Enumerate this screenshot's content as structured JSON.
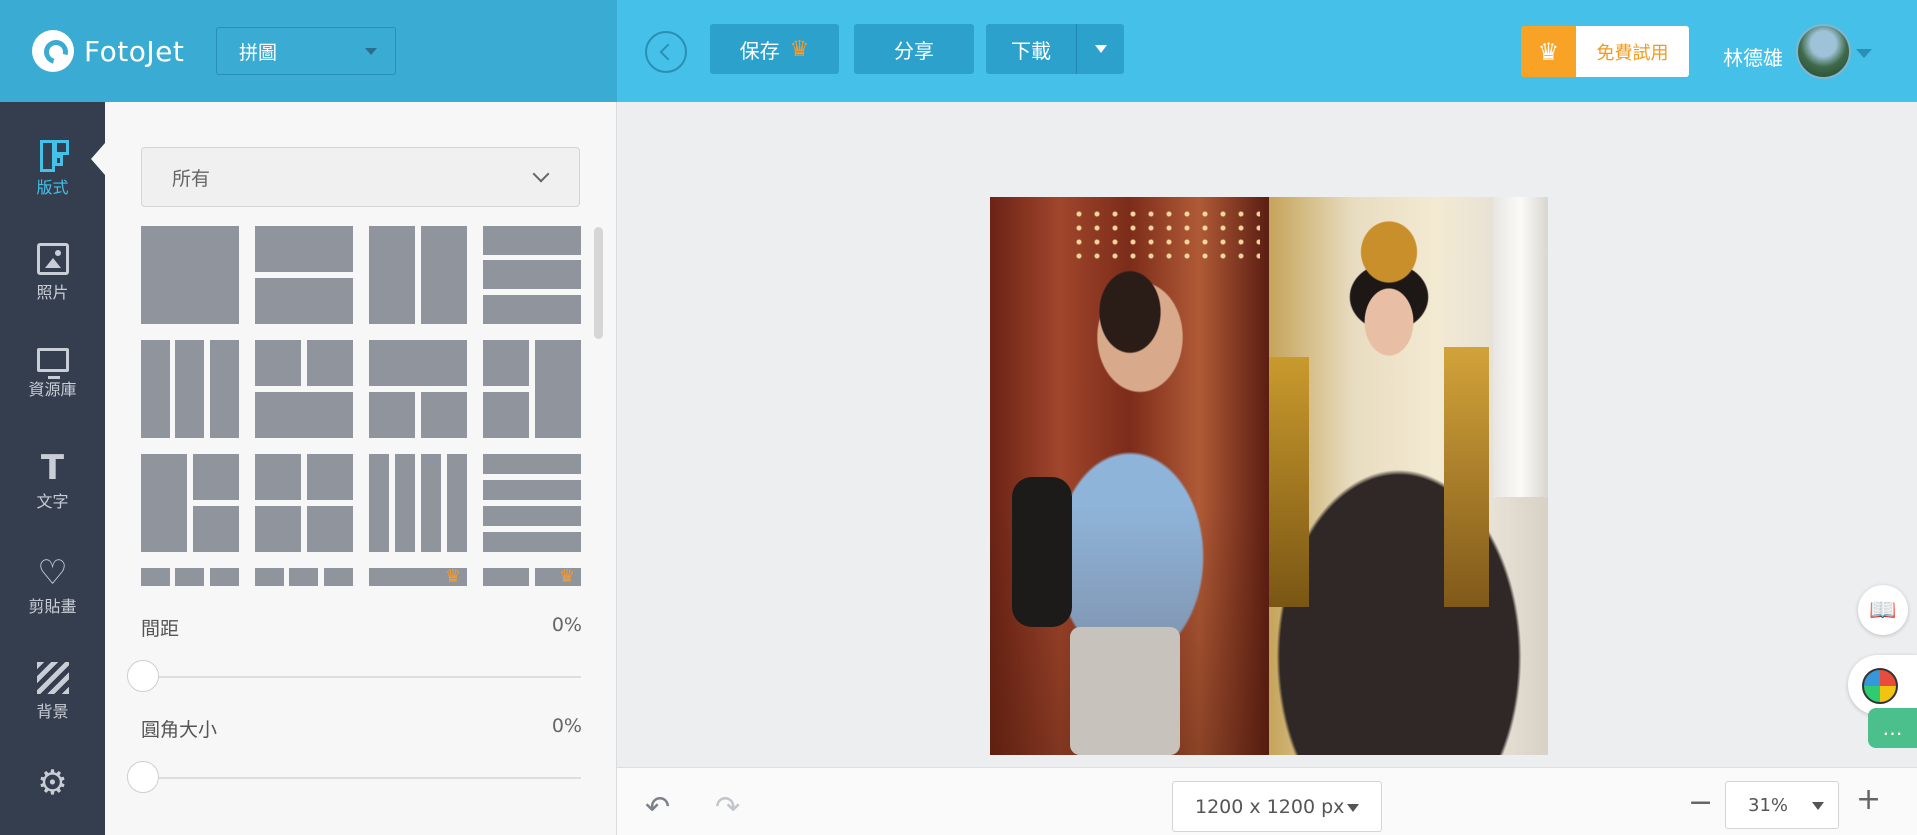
{
  "app": {
    "logo_text": "FotoJet",
    "mode_label": "拼圖"
  },
  "toolbar": {
    "save_label": "保存",
    "share_label": "分享",
    "download_label": "下載",
    "trial_label": "免費試用",
    "username": "林德雄"
  },
  "sidebar": {
    "items": [
      {
        "label": "版式",
        "icon": "layout-icon",
        "active": true
      },
      {
        "label": "照片",
        "icon": "photo-icon",
        "active": false
      },
      {
        "label": "資源庫",
        "icon": "monitor-icon",
        "active": false
      },
      {
        "label": "文字",
        "icon": "text-icon",
        "active": false
      },
      {
        "label": "剪貼畫",
        "icon": "heart-icon",
        "active": false
      },
      {
        "label": "背景",
        "icon": "background-icon",
        "active": false
      }
    ],
    "settings_icon": "gear-icon"
  },
  "panel": {
    "category_value": "所有",
    "spacing_label": "間距",
    "spacing_value": "0%",
    "corner_label": "圓角大小",
    "corner_value": "0%"
  },
  "bottom": {
    "canvas_size": "1200 x 1200 px",
    "zoom": "31%"
  },
  "colors": {
    "header_left": "#3aabd2",
    "header_right": "#45c0e8",
    "rail_bg": "#353e4f",
    "accent": "#45c0e8",
    "premium": "#f8a325"
  }
}
